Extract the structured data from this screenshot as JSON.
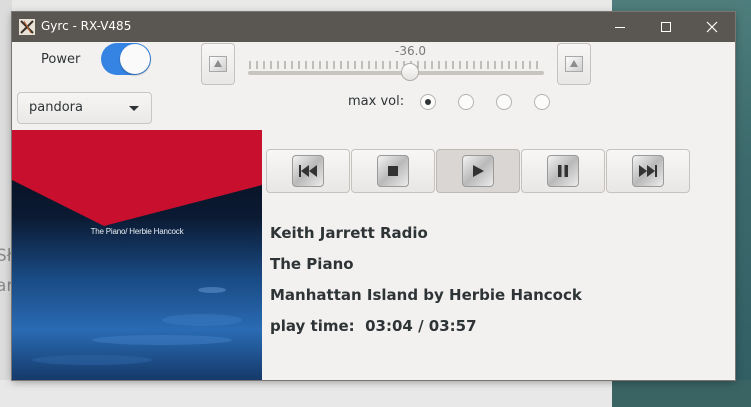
{
  "window": {
    "title": "Gyrc - RX-V485"
  },
  "background_peek": {
    "line1": "Sł",
    "line2": "ar"
  },
  "power": {
    "label": "Power",
    "on": true
  },
  "source": {
    "selected": "pandora"
  },
  "volume": {
    "value": "-36.0",
    "max_vol_label": "max vol:",
    "max_vol_options": 4,
    "max_vol_selected_index": 0
  },
  "album_art": {
    "caption": "The Piano/ Herbie Hancock"
  },
  "transport": {
    "buttons": [
      "previous",
      "stop",
      "play",
      "pause",
      "next"
    ],
    "active": "play"
  },
  "now_playing": {
    "station": "Keith Jarrett Radio",
    "album": "The Piano",
    "track_artist": "Manhattan Island by Herbie Hancock",
    "play_time": "play time:  03:04 / 03:57"
  },
  "colors": {
    "accent": "#3584e4",
    "titlebar": "#5a5652"
  }
}
